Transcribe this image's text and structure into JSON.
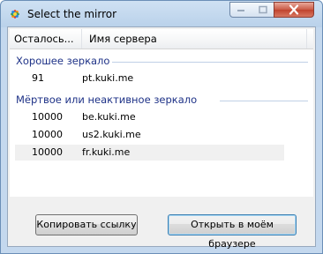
{
  "window": {
    "title": "Select the mirror",
    "controls": {
      "minimize": "minimize-icon",
      "maximize": "maximize-icon",
      "close": "close-icon"
    }
  },
  "list": {
    "columns": [
      "Осталось...",
      "Имя сервера"
    ],
    "groups": [
      {
        "title": "Хорошее зеркало",
        "rows": [
          {
            "remaining": "91",
            "server": "pt.kuki.me"
          }
        ]
      },
      {
        "title": "Мёртвое или неактивное зеркало",
        "rows": [
          {
            "remaining": "10000",
            "server": "be.kuki.me"
          },
          {
            "remaining": "10000",
            "server": "us2.kuki.me"
          },
          {
            "remaining": "10000",
            "server": "fr.kuki.me"
          }
        ]
      }
    ]
  },
  "buttons": {
    "copy_link": "Копировать ссылку",
    "open_browser": "Открыть в моём браузере"
  },
  "colors": {
    "group_header": "#1e3287",
    "selected_row": "#f0f0f0"
  }
}
